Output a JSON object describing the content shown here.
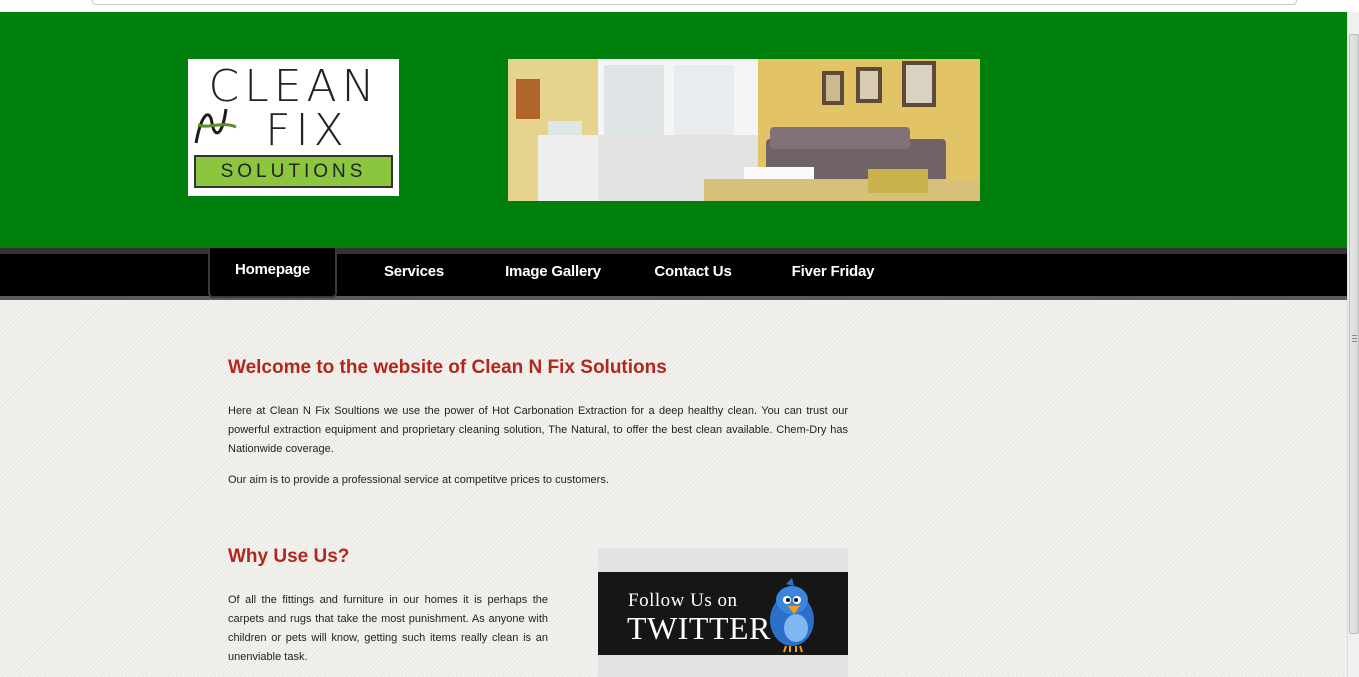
{
  "logo": {
    "line1": "CLEAN",
    "line2": "FIX",
    "line3": "SOLUTIONS"
  },
  "nav": {
    "items": [
      {
        "label": "Homepage",
        "active": true
      },
      {
        "label": "Services",
        "active": false
      },
      {
        "label": "Image Gallery",
        "active": false
      },
      {
        "label": "Contact Us",
        "active": false
      },
      {
        "label": "Fiver Friday",
        "active": false
      }
    ]
  },
  "welcome": {
    "title": "Welcome to the website of Clean N Fix Solutions",
    "para1": "Here at Clean N Fix Soultions we use the power of Hot Carbonation Extraction for a deep healthy clean. You can trust our powerful extraction equipment and proprietary cleaning solution, The Natural, to offer the best clean available. Chem-Dry has Nationwide coverage.",
    "para2": "Our aim is to provide a professional service at competitve prices to customers."
  },
  "why": {
    "title": "Why Use Us?",
    "para": "Of all the fittings and furniture in our homes it is perhaps the carpets and rugs that take the most punishment. As anyone with children or pets will know, getting such items really clean is an unenviable task."
  },
  "twitter": {
    "line1": "Follow Us on",
    "line2": "TWITTER"
  },
  "colors": {
    "header_green": "#007f0d",
    "heading_red": "#b3261e",
    "nav_black": "#000000",
    "logo_green": "#8cc63f"
  }
}
